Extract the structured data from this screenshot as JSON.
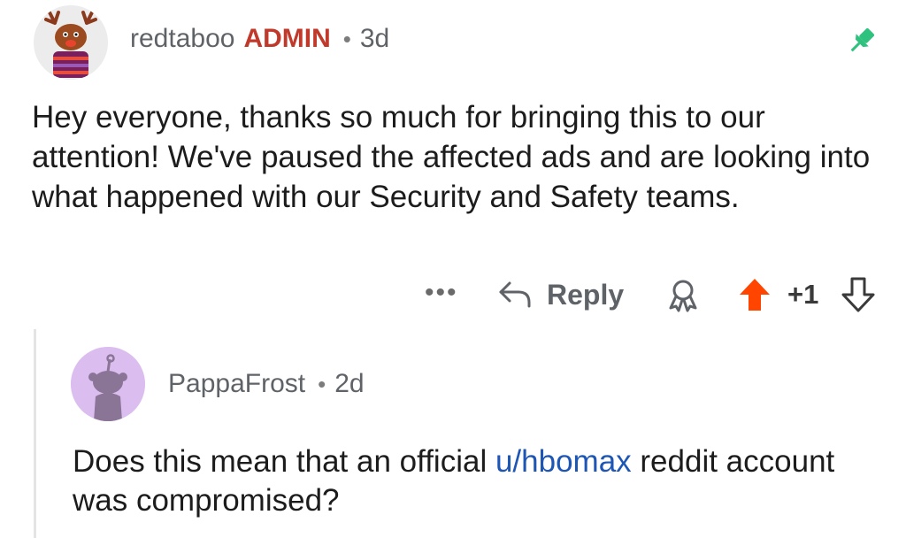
{
  "comment": {
    "username": "redtaboo",
    "badge": "ADMIN",
    "separator": "•",
    "age": "3d",
    "body": "Hey everyone, thanks so much for bringing this to our attention! We've paused the affected ads and are looking into what happened with our Security and Safety teams.",
    "pin_icon": "pin-icon",
    "actions": {
      "more_label": "•••",
      "reply_label": "Reply",
      "score": "+1"
    }
  },
  "reply": {
    "username": "PappaFrost",
    "separator": "•",
    "age": "2d",
    "body_before": "Does this mean that an official ",
    "body_link": "u/hbomax",
    "body_after": " reddit account was compromised?"
  },
  "colors": {
    "admin": "#c0392b",
    "pin": "#2ec27e",
    "upvote": "#ff4500",
    "link": "#1d56b5",
    "avatar_bg": "#dcbdf0"
  }
}
